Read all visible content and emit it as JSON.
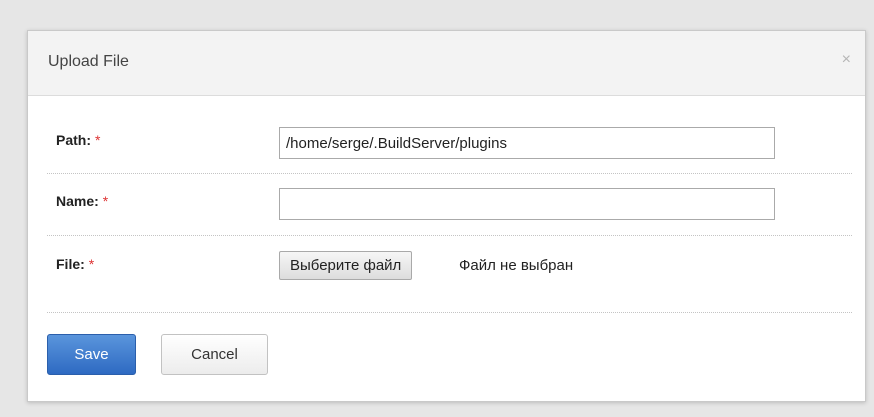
{
  "dialog": {
    "title": "Upload File",
    "close_glyph": "×"
  },
  "form": {
    "required_marker": "*",
    "path": {
      "label": "Path:",
      "value": "/home/serge/.BuildServer/plugins"
    },
    "name": {
      "label": "Name:",
      "value": ""
    },
    "file": {
      "label": "File:",
      "button_label": "Выберите файл",
      "status": "Файл не выбран"
    }
  },
  "actions": {
    "save_label": "Save",
    "cancel_label": "Cancel"
  },
  "colors": {
    "primary": "#2e6ac2",
    "required": "#dd3333"
  },
  "icons": {
    "close": "close-icon"
  }
}
